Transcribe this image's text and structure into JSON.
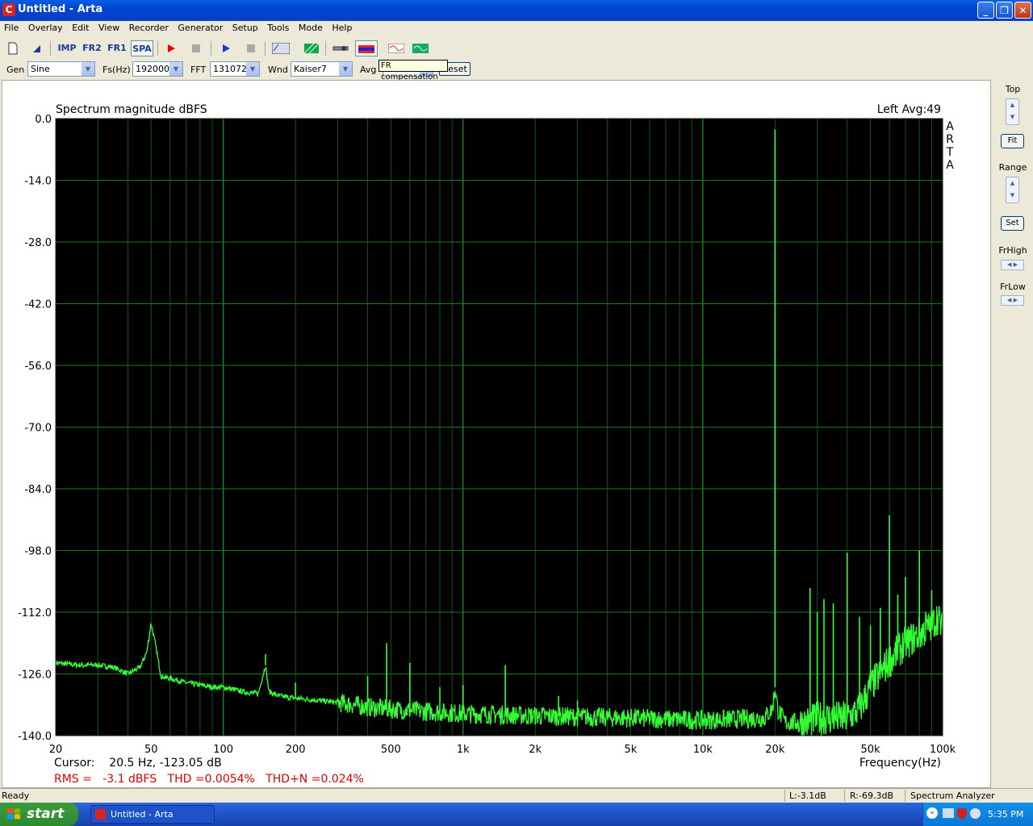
{
  "window": {
    "title": "Untitled - Arta",
    "app_icon": "C"
  },
  "menu": [
    "File",
    "Overlay",
    "Edit",
    "View",
    "Recorder",
    "Generator",
    "Setup",
    "Tools",
    "Mode",
    "Help"
  ],
  "toolbar": {
    "imp": "IMP",
    "fr2": "FR2",
    "fr1": "FR1",
    "spa": "SPA",
    "tooltip": "FR compensation"
  },
  "controls": {
    "gen_label": "Gen",
    "gen_value": "Sine",
    "fs_label": "Fs(Hz)",
    "fs_value": "192000",
    "fft_label": "FFT",
    "fft_value": "131072",
    "wnd_label": "Wnd",
    "wnd_value": "Kaiser7",
    "avg_label": "Avg",
    "reset_label": "Reset"
  },
  "side_panel": {
    "top_label": "Top",
    "fit_label": "Fit",
    "range_label": "Range",
    "set_label": "Set",
    "frhigh_label": "FrHigh",
    "frlow_label": "FrLow"
  },
  "plot": {
    "title": "Spectrum magnitude dBFS",
    "channel_info": "Left  Avg:49",
    "watermark": [
      "A",
      "R",
      "T",
      "A"
    ],
    "cursor": "Cursor:    20.5 Hz, -123.05 dB",
    "metrics": "RMS =   -3.1 dBFS   THD =0.0054%   THD+N =0.024%",
    "xlabel": "Frequency(Hz)"
  },
  "chart_data": {
    "type": "line",
    "title": "Spectrum magnitude dBFS",
    "xlabel": "Frequency(Hz)",
    "ylabel": "",
    "xscale": "log",
    "xlim": [
      20,
      100000
    ],
    "ylim": [
      -140,
      0
    ],
    "grid": true,
    "y_ticks": [
      "0.0",
      "-14.0",
      "-28.0",
      "-42.0",
      "-56.0",
      "-70.0",
      "-84.0",
      "-98.0",
      "-112.0",
      "-126.0",
      "-140.0"
    ],
    "x_ticks": [
      {
        "v": 20,
        "label": "20"
      },
      {
        "v": 50,
        "label": "50"
      },
      {
        "v": 100,
        "label": "100"
      },
      {
        "v": 200,
        "label": "200"
      },
      {
        "v": 500,
        "label": "500"
      },
      {
        "v": 1000,
        "label": "1k"
      },
      {
        "v": 2000,
        "label": "2k"
      },
      {
        "v": 5000,
        "label": "5k"
      },
      {
        "v": 10000,
        "label": "10k"
      },
      {
        "v": 20000,
        "label": "20k"
      },
      {
        "v": 50000,
        "label": "50k"
      },
      {
        "v": 100000,
        "label": "100k"
      }
    ],
    "series": [
      {
        "color": "#33ff33",
        "floor": [
          [
            20,
            -123.5
          ],
          [
            25,
            -124
          ],
          [
            30,
            -124
          ],
          [
            35,
            -124.5
          ],
          [
            40,
            -126
          ],
          [
            45,
            -124.5
          ],
          [
            48,
            -121
          ],
          [
            50,
            -114.5
          ],
          [
            52,
            -119
          ],
          [
            55,
            -126.5
          ],
          [
            60,
            -127
          ],
          [
            70,
            -128
          ],
          [
            80,
            -128.5
          ],
          [
            90,
            -129
          ],
          [
            100,
            -129
          ],
          [
            120,
            -130
          ],
          [
            140,
            -130.5
          ],
          [
            150,
            -124
          ],
          [
            155,
            -130
          ],
          [
            170,
            -131
          ],
          [
            200,
            -131.5
          ],
          [
            250,
            -132
          ],
          [
            300,
            -132.5
          ],
          [
            400,
            -133.5
          ],
          [
            500,
            -134
          ],
          [
            700,
            -134.5
          ],
          [
            1000,
            -135
          ],
          [
            2000,
            -135.5
          ],
          [
            5000,
            -136
          ],
          [
            10000,
            -136.5
          ],
          [
            18000,
            -136
          ],
          [
            19500,
            -134
          ],
          [
            20000,
            -129
          ],
          [
            20500,
            -134
          ],
          [
            22000,
            -137
          ],
          [
            28000,
            -137
          ],
          [
            30000,
            -136
          ],
          [
            40000,
            -136
          ],
          [
            45000,
            -134
          ],
          [
            50000,
            -129
          ],
          [
            60000,
            -123
          ],
          [
            70000,
            -119
          ],
          [
            80000,
            -117
          ],
          [
            90000,
            -115
          ],
          [
            95000,
            -113
          ],
          [
            100000,
            -116
          ]
        ],
        "peaks": [
          [
            20000,
            -2.5
          ],
          [
            150,
            -121.5
          ],
          [
            200,
            -128
          ],
          [
            400,
            -126.5
          ],
          [
            480,
            -119
          ],
          [
            600,
            -123.5
          ],
          [
            800,
            -129
          ],
          [
            1000,
            -128.5
          ],
          [
            1500,
            -124
          ],
          [
            2500,
            -131
          ],
          [
            3000,
            -132
          ],
          [
            28000,
            -106.5
          ],
          [
            30000,
            -112
          ],
          [
            32000,
            -109
          ],
          [
            35000,
            -110
          ],
          [
            40000,
            -98.5
          ],
          [
            45000,
            -113
          ],
          [
            50000,
            -115
          ],
          [
            55000,
            -111
          ],
          [
            60000,
            -90
          ],
          [
            65000,
            -108
          ],
          [
            70000,
            -104
          ],
          [
            80000,
            -98
          ],
          [
            85000,
            -112
          ],
          [
            90000,
            -107
          ]
        ]
      }
    ]
  },
  "statusbar": {
    "ready": "Ready",
    "l": "L:-3.1dB",
    "r": "R:-69.3dB",
    "mode": "Spectrum Analyzer"
  },
  "taskbar": {
    "start": "start",
    "item": "Untitled - Arta",
    "clock": "5:35 PM"
  }
}
